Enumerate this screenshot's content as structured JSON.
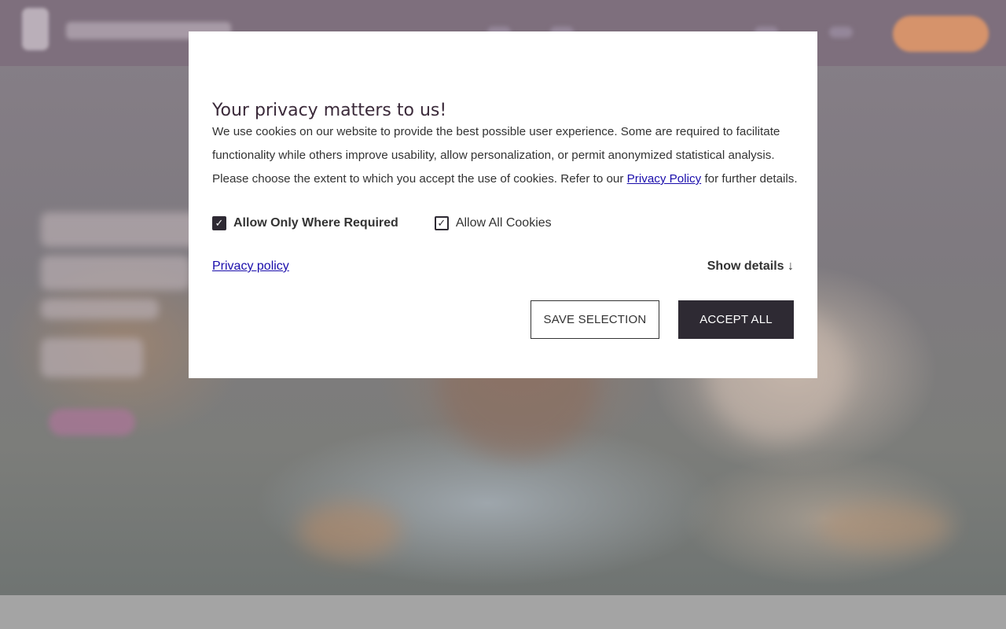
{
  "consent": {
    "title": "Your privacy matters to us!",
    "body_text": "We use cookies on our website to provide the best possible user experience. Some are required to facilitate functionality while others improve usability, allow personalization, or permit anonymized statistical analysis. Please choose the extent to which you accept the use of cookies. Refer to our",
    "body_link": "Privacy Policy",
    "body_tail": "for further details.",
    "options": [
      {
        "label": "Allow Only Where Required",
        "checked": true,
        "style": "filled"
      },
      {
        "label": "Allow All Cookies",
        "checked": true,
        "style": "outline"
      }
    ],
    "check_glyph": "✓",
    "privacy_link": "Privacy policy",
    "show_details": "Show details ↓",
    "buttons": {
      "save": "SAVE SELECTION",
      "accept": "ACCEPT ALL"
    },
    "colors": {
      "dark": "#2e2a33",
      "title": "#3b2a3a",
      "link": "#1a0dab",
      "overlay_header": "#7e6f7d",
      "cta_orange": "#d6936b"
    },
    "icons": {
      "checkbox_checked": "check-icon"
    }
  }
}
